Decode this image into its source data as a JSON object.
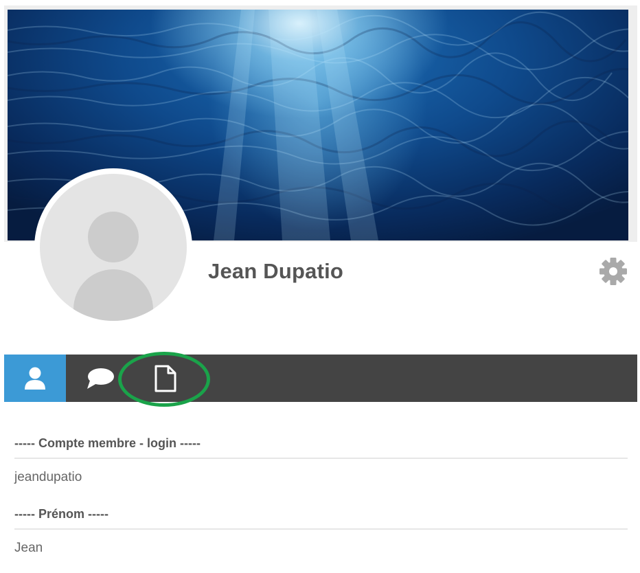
{
  "profile": {
    "name": "Jean Dupatio"
  },
  "tabs": [
    {
      "id": "profile",
      "icon": "user-icon",
      "active": true
    },
    {
      "id": "messages",
      "icon": "speech-bubble-icon",
      "active": false
    },
    {
      "id": "documents",
      "icon": "document-icon",
      "active": false,
      "highlighted": true
    }
  ],
  "fields": [
    {
      "label": "----- Compte membre - login -----",
      "value": "jeandupatio"
    },
    {
      "label": "----- Prénom -----",
      "value": "Jean"
    }
  ],
  "colors": {
    "tab_bar": "#444444",
    "active_tab": "#3c9ad6",
    "highlight_ring": "#1aa34a",
    "text": "#555555"
  }
}
